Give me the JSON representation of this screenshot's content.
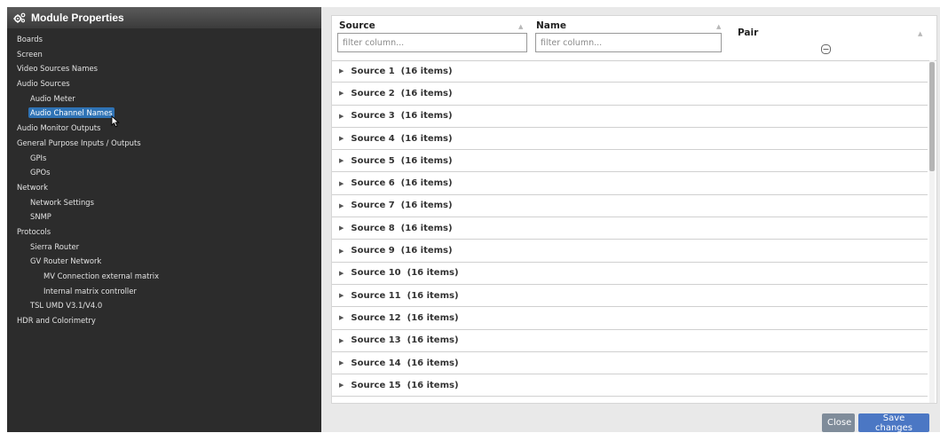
{
  "panel": {
    "title": "Module Properties"
  },
  "tree": [
    {
      "label": "Boards",
      "level": 0
    },
    {
      "label": "Screen",
      "level": 0
    },
    {
      "label": "Video Sources Names",
      "level": 0
    },
    {
      "label": "Audio Sources",
      "level": 0
    },
    {
      "label": "Audio Meter",
      "level": 1
    },
    {
      "label": "Audio Channel Names",
      "level": 1,
      "selected": true
    },
    {
      "label": "Audio Monitor Outputs",
      "level": 0
    },
    {
      "label": "General Purpose Inputs / Outputs",
      "level": 0
    },
    {
      "label": "GPIs",
      "level": 1
    },
    {
      "label": "GPOs",
      "level": 1
    },
    {
      "label": "Network",
      "level": 0
    },
    {
      "label": "Network Settings",
      "level": 1
    },
    {
      "label": "SNMP",
      "level": 1
    },
    {
      "label": "Protocols",
      "level": 0
    },
    {
      "label": "Sierra Router",
      "level": 1
    },
    {
      "label": "GV Router Network",
      "level": 1
    },
    {
      "label": "MV Connection external matrix",
      "level": 2
    },
    {
      "label": "Internal matrix controller",
      "level": 2
    },
    {
      "label": "TSL UMD V3.1/V4.0",
      "level": 1
    },
    {
      "label": "HDR and Colorimetry",
      "level": 0
    }
  ],
  "grid": {
    "columns": {
      "source": "Source",
      "name": "Name",
      "pair": "Pair"
    },
    "filters": {
      "source_placeholder": "filter column...",
      "name_placeholder": "filter column..."
    },
    "groups": [
      {
        "label": "Source 1",
        "count": "(16 items)"
      },
      {
        "label": "Source 2",
        "count": "(16 items)"
      },
      {
        "label": "Source 3",
        "count": "(16 items)"
      },
      {
        "label": "Source 4",
        "count": "(16 items)"
      },
      {
        "label": "Source 5",
        "count": "(16 items)"
      },
      {
        "label": "Source 6",
        "count": "(16 items)"
      },
      {
        "label": "Source 7",
        "count": "(16 items)"
      },
      {
        "label": "Source 8",
        "count": "(16 items)"
      },
      {
        "label": "Source 9",
        "count": "(16 items)"
      },
      {
        "label": "Source 10",
        "count": "(16 items)"
      },
      {
        "label": "Source 11",
        "count": "(16 items)"
      },
      {
        "label": "Source 12",
        "count": "(16 items)"
      },
      {
        "label": "Source 13",
        "count": "(16 items)"
      },
      {
        "label": "Source 14",
        "count": "(16 items)"
      },
      {
        "label": "Source 15",
        "count": "(16 items)"
      }
    ]
  },
  "footer": {
    "close_label": "Close",
    "save_label": "Save changes"
  },
  "colors": {
    "selection": "#2f73b5",
    "save_button": "#4b77c4",
    "close_button": "#7f8c9a",
    "panel_background": "#2c2c2c"
  }
}
